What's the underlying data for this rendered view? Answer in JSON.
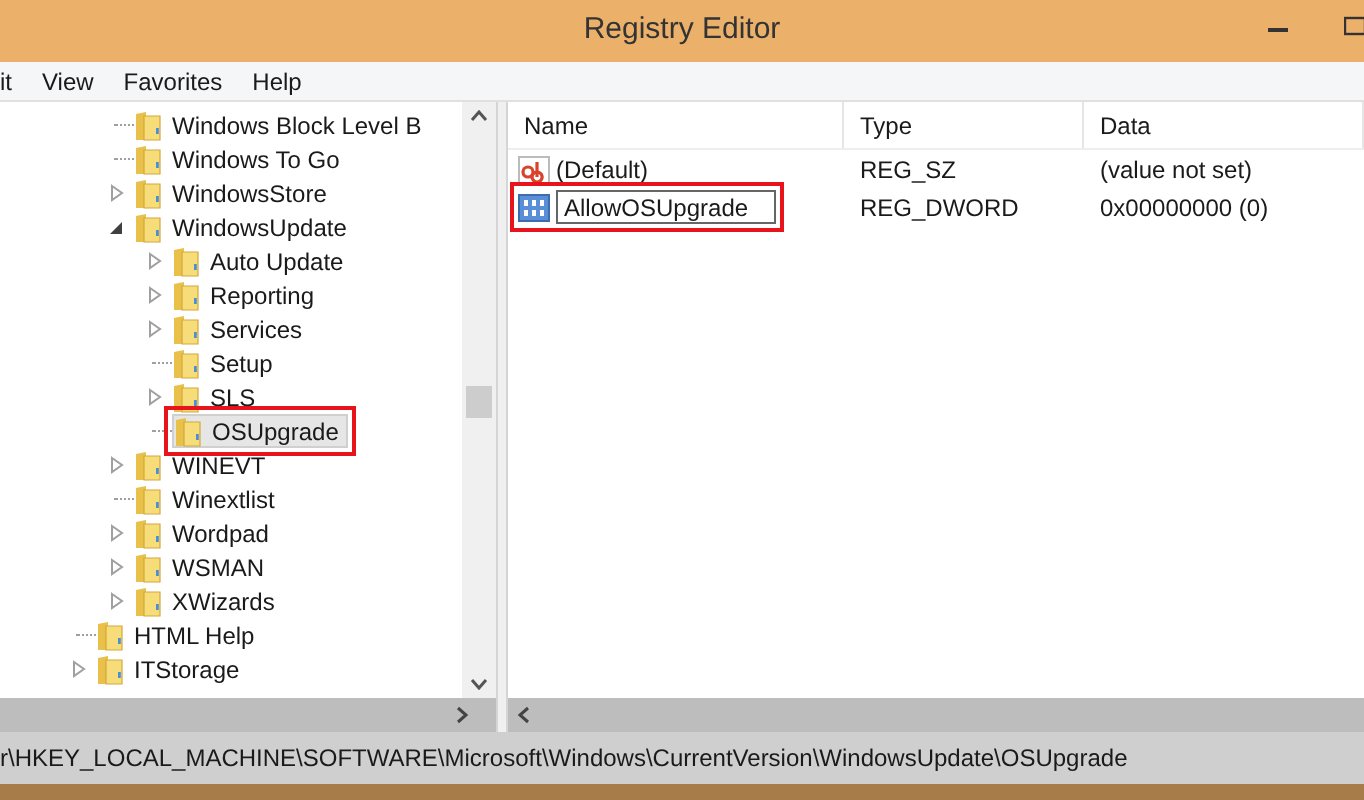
{
  "window": {
    "title": "Registry Editor"
  },
  "menu": [
    {
      "label": "it"
    },
    {
      "label": "View"
    },
    {
      "label": "Favorites"
    },
    {
      "label": "Help"
    }
  ],
  "tree": {
    "items": [
      {
        "children": [
          {
            "label": "Windows Block Level B",
            "expandable": false,
            "selected": false,
            "highlighted": false
          },
          {
            "label": "Windows To Go",
            "expandable": false,
            "selected": false,
            "highlighted": false
          },
          {
            "label": "WindowsStore",
            "expandable": true,
            "expanded": false,
            "selected": false,
            "highlighted": false
          },
          {
            "label": "WindowsUpdate",
            "expandable": true,
            "expanded": true,
            "selected": false,
            "highlighted": false,
            "children": [
              {
                "label": "Auto Update",
                "expandable": true,
                "expanded": false,
                "selected": false,
                "highlighted": false
              },
              {
                "label": "Reporting",
                "expandable": true,
                "expanded": false,
                "selected": false,
                "highlighted": false
              },
              {
                "label": "Services",
                "expandable": true,
                "expanded": false,
                "selected": false,
                "highlighted": false
              },
              {
                "label": "Setup",
                "expandable": false,
                "selected": false,
                "highlighted": false
              },
              {
                "label": "SLS",
                "expandable": true,
                "expanded": false,
                "selected": false,
                "highlighted": false
              },
              {
                "label": "OSUpgrade",
                "expandable": false,
                "selected": true,
                "highlighted": true
              }
            ]
          },
          {
            "label": "WINEVT",
            "expandable": true,
            "expanded": false,
            "selected": false,
            "highlighted": false
          },
          {
            "label": "Winextlist",
            "expandable": false,
            "selected": false,
            "highlighted": false
          },
          {
            "label": "Wordpad",
            "expandable": true,
            "expanded": false,
            "selected": false,
            "highlighted": false
          },
          {
            "label": "WSMAN",
            "expandable": true,
            "expanded": false,
            "selected": false,
            "highlighted": false
          },
          {
            "label": "XWizards",
            "expandable": true,
            "expanded": false,
            "selected": false,
            "highlighted": false
          }
        ]
      },
      {
        "label": "HTML Help",
        "expandable": false,
        "selected": false,
        "highlighted": false
      },
      {
        "label": "ITStorage",
        "expandable": true,
        "expanded": false,
        "selected": false,
        "highlighted": false
      }
    ]
  },
  "values": {
    "columns": [
      "Name",
      "Type",
      "Data"
    ],
    "rows": [
      {
        "kind": "string",
        "name": "(Default)",
        "type": "REG_SZ",
        "data": "(value not set)",
        "editing": false,
        "highlighted": false
      },
      {
        "kind": "dword",
        "name": "AllowOSUpgrade",
        "type": "REG_DWORD",
        "data": "0x00000000 (0)",
        "editing": true,
        "highlighted": true
      }
    ]
  },
  "status_bar": {
    "path": "r\\HKEY_LOCAL_MACHINE\\SOFTWARE\\Microsoft\\Windows\\CurrentVersion\\WindowsUpdate\\OSUpgrade"
  }
}
